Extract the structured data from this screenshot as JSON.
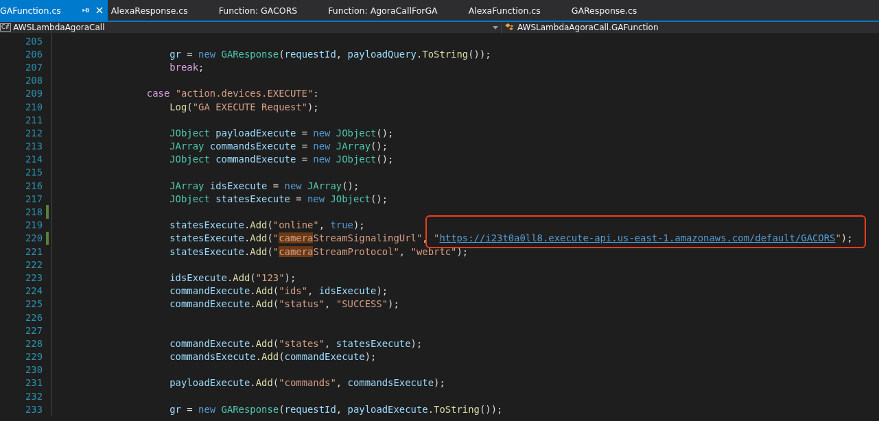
{
  "tabs": [
    {
      "label": "GAFunction.cs",
      "selected": true
    },
    {
      "label": "AlexaResponse.cs",
      "selected": false
    },
    {
      "label": "Function: GACORS",
      "selected": false
    },
    {
      "label": "Function: AgoraCallForGA",
      "selected": false
    },
    {
      "label": "AlexaFunction.cs",
      "selected": false
    },
    {
      "label": "GAResponse.cs",
      "selected": false
    }
  ],
  "nav_bar": {
    "project_badge": "C#",
    "project": "AWSLambdaAgoraCall",
    "member": "AWSLambdaAgoraCall.GAFunction"
  },
  "editor": {
    "lines": [
      {
        "number": "205",
        "changed": false
      },
      {
        "number": "206",
        "changed": false,
        "tokens": [
          {
            "text": "                    gr",
            "kind": "id"
          },
          {
            "text": " = ",
            "kind": "p"
          },
          {
            "text": "new ",
            "kind": "kw"
          },
          {
            "text": "GAResponse",
            "kind": "type"
          },
          {
            "text": "(",
            "kind": "p"
          },
          {
            "text": "requestId",
            "kind": "id"
          },
          {
            "text": ", ",
            "kind": "p"
          },
          {
            "text": "payloadQuery",
            "kind": "id"
          },
          {
            "text": ".",
            "kind": "p"
          },
          {
            "text": "ToString",
            "kind": "fn"
          },
          {
            "text": "());",
            "kind": "p"
          }
        ]
      },
      {
        "number": "207",
        "changed": false,
        "tokens": [
          {
            "text": "                    break",
            "kind": "ctl"
          },
          {
            "text": ";",
            "kind": "p"
          }
        ]
      },
      {
        "number": "208",
        "changed": false
      },
      {
        "number": "209",
        "changed": false,
        "tokens": [
          {
            "text": "                case ",
            "kind": "ctl"
          },
          {
            "text": "\"action.devices.EXECUTE\"",
            "kind": "str"
          },
          {
            "text": ":",
            "kind": "p"
          }
        ]
      },
      {
        "number": "210",
        "changed": false,
        "tokens": [
          {
            "text": "                    Log",
            "kind": "fn"
          },
          {
            "text": "(",
            "kind": "p"
          },
          {
            "text": "\"GA EXECUTE Request\"",
            "kind": "str"
          },
          {
            "text": ");",
            "kind": "p"
          }
        ]
      },
      {
        "number": "211",
        "changed": false
      },
      {
        "number": "212",
        "changed": false,
        "tokens": [
          {
            "text": "                    JObject ",
            "kind": "type"
          },
          {
            "text": "payloadExecute",
            "kind": "id"
          },
          {
            "text": " = ",
            "kind": "p"
          },
          {
            "text": "new ",
            "kind": "kw"
          },
          {
            "text": "JObject",
            "kind": "type"
          },
          {
            "text": "();",
            "kind": "p"
          }
        ]
      },
      {
        "number": "213",
        "changed": false,
        "tokens": [
          {
            "text": "                    JArray ",
            "kind": "type"
          },
          {
            "text": "commandsExecute",
            "kind": "id"
          },
          {
            "text": " = ",
            "kind": "p"
          },
          {
            "text": "new ",
            "kind": "kw"
          },
          {
            "text": "JArray",
            "kind": "type"
          },
          {
            "text": "();",
            "kind": "p"
          }
        ]
      },
      {
        "number": "214",
        "changed": false,
        "tokens": [
          {
            "text": "                    JObject ",
            "kind": "type"
          },
          {
            "text": "commandExecute",
            "kind": "id"
          },
          {
            "text": " = ",
            "kind": "p"
          },
          {
            "text": "new ",
            "kind": "kw"
          },
          {
            "text": "JObject",
            "kind": "type"
          },
          {
            "text": "();",
            "kind": "p"
          }
        ]
      },
      {
        "number": "215",
        "changed": false
      },
      {
        "number": "216",
        "changed": false,
        "tokens": [
          {
            "text": "                    JArray ",
            "kind": "type"
          },
          {
            "text": "idsExecute",
            "kind": "id"
          },
          {
            "text": " = ",
            "kind": "p"
          },
          {
            "text": "new ",
            "kind": "kw"
          },
          {
            "text": "JArray",
            "kind": "type"
          },
          {
            "text": "();",
            "kind": "p"
          }
        ]
      },
      {
        "number": "217",
        "changed": false,
        "tokens": [
          {
            "text": "                    JObject ",
            "kind": "type"
          },
          {
            "text": "statesExecute",
            "kind": "id"
          },
          {
            "text": " = ",
            "kind": "p"
          },
          {
            "text": "new ",
            "kind": "kw"
          },
          {
            "text": "JObject",
            "kind": "type"
          },
          {
            "text": "();",
            "kind": "p"
          }
        ]
      },
      {
        "number": "218",
        "changed": true
      },
      {
        "number": "219",
        "changed": false,
        "tokens": [
          {
            "text": "                    statesExecute",
            "kind": "id"
          },
          {
            "text": ".",
            "kind": "p"
          },
          {
            "text": "Add",
            "kind": "fn"
          },
          {
            "text": "(",
            "kind": "p"
          },
          {
            "text": "\"online\"",
            "kind": "str"
          },
          {
            "text": ", ",
            "kind": "p"
          },
          {
            "text": "true",
            "kind": "kw"
          },
          {
            "text": ");",
            "kind": "p"
          }
        ]
      },
      {
        "number": "220",
        "changed": true,
        "tokens": [
          {
            "text": "                    statesExecute",
            "kind": "id"
          },
          {
            "text": ".",
            "kind": "p"
          },
          {
            "text": "Add",
            "kind": "fn"
          },
          {
            "text": "(",
            "kind": "p"
          },
          {
            "text": "\"",
            "kind": "str"
          },
          {
            "text": "camera",
            "kind": "hl"
          },
          {
            "text": "StreamSignalingUrl\"",
            "kind": "str"
          },
          {
            "text": ", ",
            "kind": "p"
          },
          {
            "text": "\"",
            "kind": "str"
          },
          {
            "text": "https://i23t0a0ll8.execute-api.us-east-1.amazonaws.com/default/GACORS",
            "kind": "link"
          },
          {
            "text": "\"",
            "kind": "str"
          },
          {
            "text": ");",
            "kind": "p"
          }
        ]
      },
      {
        "number": "221",
        "changed": false,
        "tokens": [
          {
            "text": "                    statesExecute",
            "kind": "id"
          },
          {
            "text": ".",
            "kind": "p"
          },
          {
            "text": "Add",
            "kind": "fn"
          },
          {
            "text": "(",
            "kind": "p"
          },
          {
            "text": "\"",
            "kind": "str"
          },
          {
            "text": "camera",
            "kind": "hl"
          },
          {
            "text": "StreamProtocol\"",
            "kind": "str"
          },
          {
            "text": ", ",
            "kind": "p"
          },
          {
            "text": "\"webrtc\"",
            "kind": "str"
          },
          {
            "text": ");",
            "kind": "p"
          }
        ]
      },
      {
        "number": "222",
        "changed": false
      },
      {
        "number": "223",
        "changed": false,
        "tokens": [
          {
            "text": "                    idsExecute",
            "kind": "id"
          },
          {
            "text": ".",
            "kind": "p"
          },
          {
            "text": "Add",
            "kind": "fn"
          },
          {
            "text": "(",
            "kind": "p"
          },
          {
            "text": "\"123\"",
            "kind": "str"
          },
          {
            "text": ");",
            "kind": "p"
          }
        ]
      },
      {
        "number": "224",
        "changed": false,
        "tokens": [
          {
            "text": "                    commandExecute",
            "kind": "id"
          },
          {
            "text": ".",
            "kind": "p"
          },
          {
            "text": "Add",
            "kind": "fn"
          },
          {
            "text": "(",
            "kind": "p"
          },
          {
            "text": "\"ids\"",
            "kind": "str"
          },
          {
            "text": ", ",
            "kind": "p"
          },
          {
            "text": "idsExecute",
            "kind": "id"
          },
          {
            "text": ");",
            "kind": "p"
          }
        ]
      },
      {
        "number": "225",
        "changed": false,
        "tokens": [
          {
            "text": "                    commandExecute",
            "kind": "id"
          },
          {
            "text": ".",
            "kind": "p"
          },
          {
            "text": "Add",
            "kind": "fn"
          },
          {
            "text": "(",
            "kind": "p"
          },
          {
            "text": "\"status\"",
            "kind": "str"
          },
          {
            "text": ", ",
            "kind": "p"
          },
          {
            "text": "\"SUCCESS\"",
            "kind": "str"
          },
          {
            "text": ");",
            "kind": "p"
          }
        ]
      },
      {
        "number": "226",
        "changed": false
      },
      {
        "number": "227",
        "changed": false
      },
      {
        "number": "228",
        "changed": false,
        "tokens": [
          {
            "text": "                    commandExecute",
            "kind": "id"
          },
          {
            "text": ".",
            "kind": "p"
          },
          {
            "text": "Add",
            "kind": "fn"
          },
          {
            "text": "(",
            "kind": "p"
          },
          {
            "text": "\"states\"",
            "kind": "str"
          },
          {
            "text": ", ",
            "kind": "p"
          },
          {
            "text": "statesExecute",
            "kind": "id"
          },
          {
            "text": ");",
            "kind": "p"
          }
        ]
      },
      {
        "number": "229",
        "changed": false,
        "tokens": [
          {
            "text": "                    commandsExecute",
            "kind": "id"
          },
          {
            "text": ".",
            "kind": "p"
          },
          {
            "text": "Add",
            "kind": "fn"
          },
          {
            "text": "(",
            "kind": "p"
          },
          {
            "text": "commandExecute",
            "kind": "id"
          },
          {
            "text": ");",
            "kind": "p"
          }
        ]
      },
      {
        "number": "230",
        "changed": false
      },
      {
        "number": "231",
        "changed": false,
        "tokens": [
          {
            "text": "                    payloadExecute",
            "kind": "id"
          },
          {
            "text": ".",
            "kind": "p"
          },
          {
            "text": "Add",
            "kind": "fn"
          },
          {
            "text": "(",
            "kind": "p"
          },
          {
            "text": "\"commands\"",
            "kind": "str"
          },
          {
            "text": ", ",
            "kind": "p"
          },
          {
            "text": "commandsExecute",
            "kind": "id"
          },
          {
            "text": ");",
            "kind": "p"
          }
        ]
      },
      {
        "number": "232",
        "changed": false
      },
      {
        "number": "233",
        "changed": false,
        "tokens": [
          {
            "text": "                    gr",
            "kind": "id"
          },
          {
            "text": " = ",
            "kind": "p"
          },
          {
            "text": "new ",
            "kind": "kw"
          },
          {
            "text": "GAResponse",
            "kind": "type"
          },
          {
            "text": "(",
            "kind": "p"
          },
          {
            "text": "requestId",
            "kind": "id"
          },
          {
            "text": ", ",
            "kind": "p"
          },
          {
            "text": "payloadExecute",
            "kind": "id"
          },
          {
            "text": ".",
            "kind": "p"
          },
          {
            "text": "ToString",
            "kind": "fn"
          },
          {
            "text": "());",
            "kind": "p"
          }
        ]
      }
    ]
  }
}
